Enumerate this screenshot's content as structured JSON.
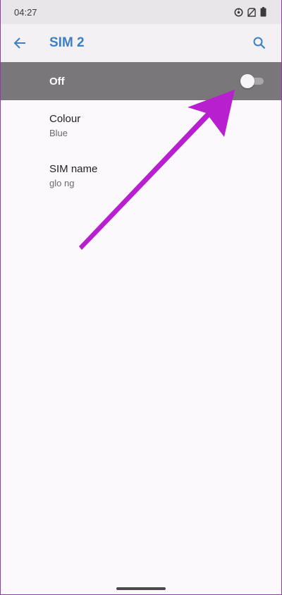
{
  "status_bar": {
    "time": "04:27"
  },
  "app_bar": {
    "title": "SIM 2"
  },
  "toggle": {
    "label": "Off",
    "state": "off"
  },
  "preferences": [
    {
      "title": "Colour",
      "subtitle": "Blue"
    },
    {
      "title": "SIM name",
      "subtitle": "glo ng"
    }
  ],
  "colors": {
    "accent": "#3d7fc3",
    "annotation_arrow": "#b81fcf",
    "toggle_row_bg": "#7a777b"
  },
  "icons": {
    "back": "back-arrow-icon",
    "search": "search-icon",
    "status": [
      "vpn-key-icon",
      "no-sim-icon",
      "battery-icon"
    ]
  }
}
